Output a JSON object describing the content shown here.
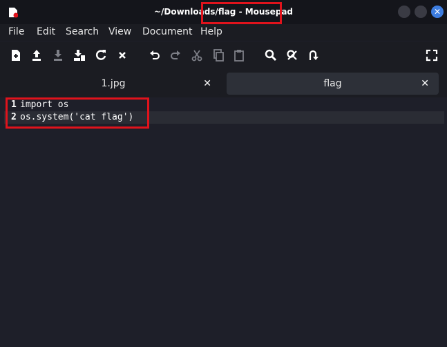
{
  "window": {
    "title": "~/Downloads/flag - Mousepad"
  },
  "menu": {
    "items": [
      "File",
      "Edit",
      "Search",
      "View",
      "Document",
      "Help"
    ]
  },
  "toolbar": {
    "buttons": [
      "new-document-icon",
      "open-icon",
      "save-icon",
      "save-as-icon",
      "reload-icon",
      "close-icon",
      "undo-icon",
      "redo-icon",
      "cut-icon",
      "copy-icon",
      "paste-icon",
      "search-icon",
      "find-replace-icon",
      "go-to-icon",
      "fullscreen-icon"
    ]
  },
  "tabs": [
    {
      "label": "1.jpg",
      "close": "✕",
      "active": false
    },
    {
      "label": "flag",
      "close": "✕",
      "active": true
    }
  ],
  "editor": {
    "lines": [
      {
        "number": "1",
        "text": "import os"
      },
      {
        "number": "2",
        "text": "os.system('cat flag')"
      }
    ],
    "current_line": 2
  },
  "colors": {
    "annotation": "#e0131c",
    "close_button": "#3d7de0"
  }
}
